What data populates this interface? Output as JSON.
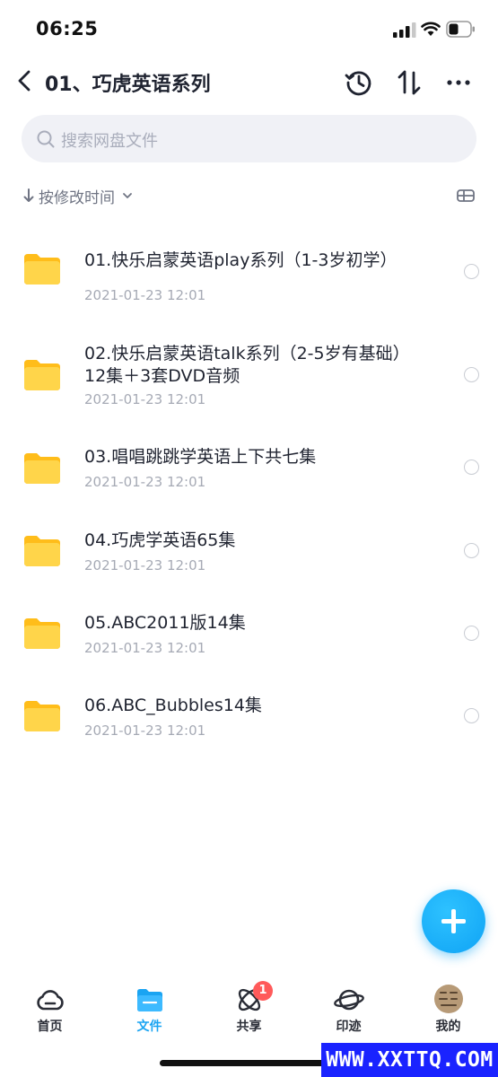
{
  "status_bar": {
    "time": "06:25"
  },
  "header": {
    "title": "01、巧虎英语系列"
  },
  "search": {
    "placeholder": "搜索网盘文件"
  },
  "sort": {
    "label": "按修改时间"
  },
  "files": [
    {
      "name": "01.快乐启蒙英语play系列（1-3岁初学）",
      "date": "2021-01-23 12:01"
    },
    {
      "name": "02.快乐启蒙英语talk系列（2-5岁有基础）12集＋3套DVD音频",
      "date": "2021-01-23 12:01"
    },
    {
      "name": "03.唱唱跳跳学英语上下共七集",
      "date": "2021-01-23 12:01"
    },
    {
      "name": "04.巧虎学英语65集",
      "date": "2021-01-23 12:01"
    },
    {
      "name": "05.ABC2011版14集",
      "date": "2021-01-23 12:01"
    },
    {
      "name": "06.ABC_Bubbles14集",
      "date": "2021-01-23 12:01"
    }
  ],
  "tabs": [
    {
      "label": "首页",
      "icon": "cloud-icon"
    },
    {
      "label": "文件",
      "icon": "folder-icon",
      "active": true
    },
    {
      "label": "共享",
      "icon": "atom-icon",
      "badge": "1"
    },
    {
      "label": "印迹",
      "icon": "planet-icon"
    },
    {
      "label": "我的",
      "icon": "avatar"
    }
  ],
  "watermark": "WWW.XXTTQ.COM",
  "colors": {
    "accent": "#1aa4f2",
    "folder": "#ffcc33",
    "badge": "#ff5a5a",
    "watermark_bg": "#1a23ff"
  }
}
